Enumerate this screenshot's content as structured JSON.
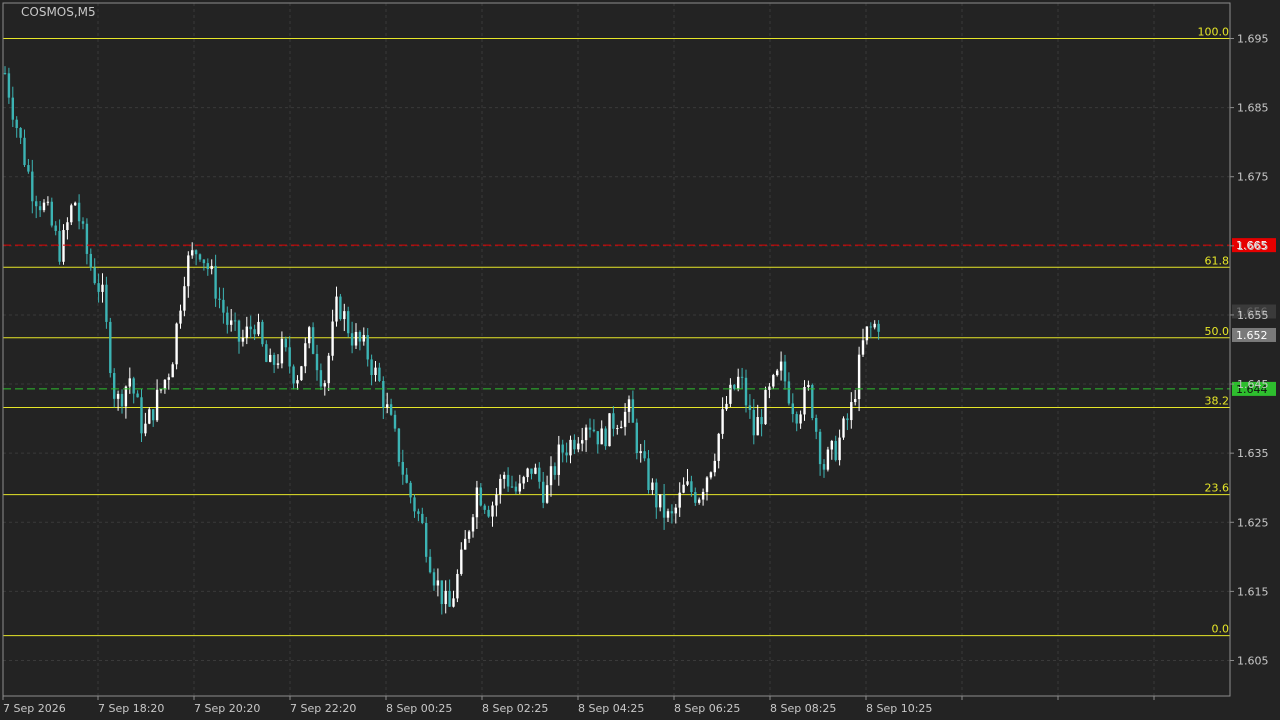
{
  "window": {
    "symbol_title": "COSMOS,M5"
  },
  "colors": {
    "background": "#232323",
    "grid": "#3a3a3a",
    "axis": "#8c8c8c",
    "text": "#c8c8c8",
    "bull_candle": "#ffffff",
    "bear_candle": "#3cb4b4",
    "fibo": "#e6e628",
    "ask_line": "#e60000",
    "bid_line": "#2ebe2e",
    "current_price_badge": "#7a7a7a"
  },
  "chart_data": {
    "type": "candlestick",
    "title": "COSMOS,M5",
    "y_ticks": [
      "1.695",
      "1.685",
      "1.675",
      "1.665",
      "1.655",
      "1.645",
      "1.635",
      "1.625",
      "1.615",
      "1.605"
    ],
    "ylim": [
      1.6033,
      1.7
    ],
    "x_ticks": [
      "7 Sep 2026",
      "7 Sep 18:20",
      "7 Sep 20:20",
      "7 Sep 22:20",
      "8 Sep 00:25",
      "8 Sep 02:25",
      "8 Sep 04:25",
      "8 Sep 06:25",
      "8 Sep 08:25",
      "8 Sep 10:25"
    ],
    "grid": true,
    "fibonacci_levels": [
      {
        "label": "100.0",
        "price": 1.695
      },
      {
        "label": "61.8",
        "price": 1.6619
      },
      {
        "label": "50.0",
        "price": 1.6517
      },
      {
        "label": "38.2",
        "price": 1.6416
      },
      {
        "label": "23.6",
        "price": 1.629
      },
      {
        "label": "0.0",
        "price": 1.6086
      }
    ],
    "price_lines": [
      {
        "name": "ask",
        "label": "1.665",
        "price": 1.6651,
        "style": "dashed"
      },
      {
        "name": "bid",
        "label": "1.644",
        "price": 1.6443,
        "style": "dashed"
      }
    ],
    "current_price": {
      "label": "1.652",
      "price": 1.6521
    },
    "hidden_label": "1.656",
    "ohlc_anchors": [
      1.69,
      1.681,
      1.673,
      1.67,
      1.664,
      1.672,
      1.663,
      1.658,
      1.642,
      1.646,
      1.638,
      1.643,
      1.648,
      1.662,
      1.665,
      1.66,
      1.654,
      1.651,
      1.654,
      1.647,
      1.65,
      1.646,
      1.652,
      1.645,
      1.657,
      1.652,
      1.65,
      1.645,
      1.638,
      1.63,
      1.625,
      1.617,
      1.612,
      1.62,
      1.63,
      1.627,
      1.632,
      1.629,
      1.633,
      1.629,
      1.635,
      1.637,
      1.64,
      1.637,
      1.64,
      1.641,
      1.633,
      1.628,
      1.625,
      1.63,
      1.629,
      1.634,
      1.642,
      1.646,
      1.638,
      1.643,
      1.647,
      1.641,
      1.644,
      1.633,
      1.636,
      1.641,
      1.652,
      1.654
    ]
  }
}
